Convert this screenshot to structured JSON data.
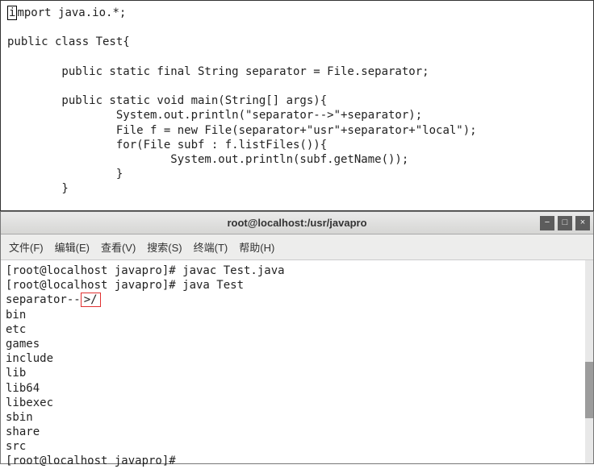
{
  "editor": {
    "line1a": "i",
    "line1b": "mport java.io.*;",
    "line2": "",
    "line3": "public class Test{",
    "line4": "",
    "line5": "        public static final String separator = File.separator;",
    "line6": "",
    "line7": "        public static void main(String[] args){",
    "line8": "                System.out.println(\"separator-->\"+separator);",
    "line9": "                File f = new File(separator+\"usr\"+separator+\"local\");",
    "line10": "                for(File subf : f.listFiles()){",
    "line11": "                        System.out.println(subf.getName());",
    "line12": "                }",
    "line13": "        }"
  },
  "terminal": {
    "title": "root@localhost:/usr/javapro",
    "menu": {
      "file": "文件(F)",
      "edit": "编辑(E)",
      "view": "查看(V)",
      "search": "搜索(S)",
      "terminal": "终端(T)",
      "help": "帮助(H)"
    },
    "out": {
      "l1": "[root@localhost javapro]# javac Test.java",
      "l2": "[root@localhost javapro]# java Test",
      "l3a": "separator--",
      "l3b": ">/",
      "l4": "bin",
      "l5": "etc",
      "l6": "games",
      "l7": "include",
      "l8": "lib",
      "l9": "lib64",
      "l10": "libexec",
      "l11": "sbin",
      "l12": "share",
      "l13": "src",
      "l14": "[root@localhost javapro]# "
    }
  }
}
